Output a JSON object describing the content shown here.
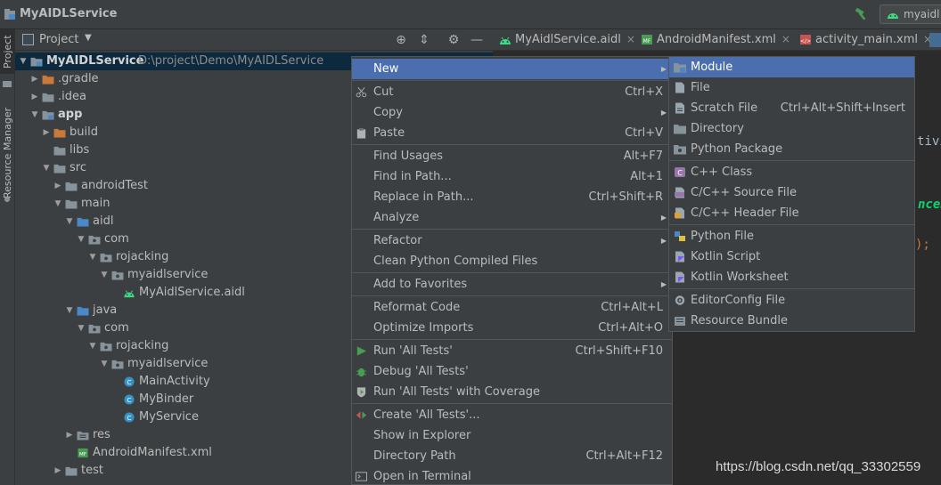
{
  "window": {
    "title": "MyAIDLService",
    "run_config": "myaidl"
  },
  "left_tool_tabs": {
    "project": "Project",
    "resource_manager": "Resource Manager"
  },
  "project_panel": {
    "title": "Project"
  },
  "tree": [
    {
      "label": "MyAIDLService",
      "path": "D:\\project\\Demo\\MyAIDLService",
      "depth": 0,
      "expanded": true,
      "icon": "module-folder-icon",
      "selected": true
    },
    {
      "label": ".gradle",
      "depth": 1,
      "expanded": false,
      "icon": "folder-orange-icon"
    },
    {
      "label": ".idea",
      "depth": 1,
      "expanded": false,
      "icon": "folder-icon"
    },
    {
      "label": "app",
      "depth": 1,
      "expanded": true,
      "icon": "module-folder-icon",
      "bold": true
    },
    {
      "label": "build",
      "depth": 2,
      "expanded": false,
      "icon": "folder-orange-icon"
    },
    {
      "label": "libs",
      "depth": 2,
      "expanded": null,
      "icon": "folder-icon"
    },
    {
      "label": "src",
      "depth": 2,
      "expanded": true,
      "icon": "folder-icon"
    },
    {
      "label": "androidTest",
      "depth": 3,
      "expanded": false,
      "icon": "folder-icon"
    },
    {
      "label": "main",
      "depth": 3,
      "expanded": true,
      "icon": "folder-icon"
    },
    {
      "label": "aidl",
      "depth": 4,
      "expanded": true,
      "icon": "source-folder-icon"
    },
    {
      "label": "com",
      "depth": 5,
      "expanded": true,
      "icon": "package-icon"
    },
    {
      "label": "rojacking",
      "depth": 6,
      "expanded": true,
      "icon": "package-icon"
    },
    {
      "label": "myaidlservice",
      "depth": 7,
      "expanded": true,
      "icon": "package-icon"
    },
    {
      "label": "MyAidlService.aidl",
      "depth": 8,
      "expanded": null,
      "icon": "android-icon"
    },
    {
      "label": "java",
      "depth": 4,
      "expanded": true,
      "icon": "source-folder-icon"
    },
    {
      "label": "com",
      "depth": 5,
      "expanded": true,
      "icon": "package-icon"
    },
    {
      "label": "rojacking",
      "depth": 6,
      "expanded": true,
      "icon": "package-icon"
    },
    {
      "label": "myaidlservice",
      "depth": 7,
      "expanded": true,
      "icon": "package-icon"
    },
    {
      "label": "MainActivity",
      "depth": 8,
      "expanded": null,
      "icon": "class-icon"
    },
    {
      "label": "MyBinder",
      "depth": 8,
      "expanded": null,
      "icon": "class-icon"
    },
    {
      "label": "MyService",
      "depth": 8,
      "expanded": null,
      "icon": "class-icon"
    },
    {
      "label": "res",
      "depth": 4,
      "expanded": false,
      "icon": "resources-folder-icon"
    },
    {
      "label": "AndroidManifest.xml",
      "depth": 4,
      "expanded": null,
      "icon": "manifest-icon"
    },
    {
      "label": "test",
      "depth": 3,
      "expanded": false,
      "icon": "folder-icon"
    }
  ],
  "editor_tabs": [
    {
      "label": "MyAidlService.aidl",
      "icon": "android-icon"
    },
    {
      "label": "AndroidManifest.xml",
      "icon": "manifest-icon"
    },
    {
      "label": "activity_main.xml",
      "icon": "layout-xml-icon"
    }
  ],
  "editor_fragments": {
    "frag1": "tivi",
    "frag2": "nceS",
    "frag3": ");"
  },
  "context_menu": {
    "groups": [
      [
        {
          "label": "New",
          "shortcut": "",
          "submenu": true,
          "icon": "",
          "highlighted": true
        }
      ],
      [
        {
          "label": "Cut",
          "shortcut": "Ctrl+X",
          "submenu": false,
          "icon": "scissors-icon"
        },
        {
          "label": "Copy",
          "shortcut": "",
          "submenu": true,
          "icon": ""
        },
        {
          "label": "Paste",
          "shortcut": "Ctrl+V",
          "submenu": false,
          "icon": "clipboard-icon"
        }
      ],
      [
        {
          "label": "Find Usages",
          "shortcut": "Alt+F7",
          "submenu": false,
          "icon": ""
        },
        {
          "label": "Find in Path...",
          "shortcut": "Alt+1",
          "submenu": false,
          "icon": ""
        },
        {
          "label": "Replace in Path...",
          "shortcut": "Ctrl+Shift+R",
          "submenu": false,
          "icon": ""
        },
        {
          "label": "Analyze",
          "shortcut": "",
          "submenu": true,
          "icon": ""
        }
      ],
      [
        {
          "label": "Refactor",
          "shortcut": "",
          "submenu": true,
          "icon": ""
        },
        {
          "label": "Clean Python Compiled Files",
          "shortcut": "",
          "submenu": false,
          "icon": ""
        }
      ],
      [
        {
          "label": "Add to Favorites",
          "shortcut": "",
          "submenu": true,
          "icon": ""
        }
      ],
      [
        {
          "label": "Reformat Code",
          "shortcut": "Ctrl+Alt+L",
          "submenu": false,
          "icon": ""
        },
        {
          "label": "Optimize Imports",
          "shortcut": "Ctrl+Alt+O",
          "submenu": false,
          "icon": ""
        }
      ],
      [
        {
          "label": "Run 'All Tests'",
          "shortcut": "Ctrl+Shift+F10",
          "submenu": false,
          "icon": "run-icon"
        },
        {
          "label": "Debug 'All Tests'",
          "shortcut": "",
          "submenu": false,
          "icon": "debug-icon"
        },
        {
          "label": "Run 'All Tests' with Coverage",
          "shortcut": "",
          "submenu": false,
          "icon": "coverage-icon"
        }
      ],
      [
        {
          "label": "Create 'All Tests'...",
          "shortcut": "",
          "submenu": false,
          "icon": "create-config-icon"
        },
        {
          "label": "Show in Explorer",
          "shortcut": "",
          "submenu": false,
          "icon": ""
        },
        {
          "label": "Directory Path",
          "shortcut": "Ctrl+Alt+F12",
          "submenu": false,
          "icon": ""
        },
        {
          "label": "Open in Terminal",
          "shortcut": "",
          "submenu": false,
          "icon": "terminal-icon"
        }
      ]
    ]
  },
  "new_submenu": {
    "groups": [
      [
        {
          "label": "Module",
          "shortcut": "",
          "icon": "module-icon",
          "highlighted": true
        },
        {
          "label": "File",
          "shortcut": "",
          "icon": "file-icon"
        },
        {
          "label": "Scratch File",
          "shortcut": "Ctrl+Alt+Shift+Insert",
          "icon": "scratch-file-icon"
        },
        {
          "label": "Directory",
          "shortcut": "",
          "icon": "directory-icon"
        },
        {
          "label": "Python Package",
          "shortcut": "",
          "icon": "python-package-icon"
        }
      ],
      [
        {
          "label": "C++ Class",
          "shortcut": "",
          "icon": "cpp-class-icon"
        },
        {
          "label": "C/C++ Source File",
          "shortcut": "",
          "icon": "cpp-source-icon"
        },
        {
          "label": "C/C++ Header File",
          "shortcut": "",
          "icon": "cpp-header-icon"
        }
      ],
      [
        {
          "label": "Python File",
          "shortcut": "",
          "icon": "python-file-icon"
        },
        {
          "label": "Kotlin Script",
          "shortcut": "",
          "icon": "kotlin-script-icon"
        },
        {
          "label": "Kotlin Worksheet",
          "shortcut": "",
          "icon": "kotlin-worksheet-icon"
        }
      ],
      [
        {
          "label": "EditorConfig File",
          "shortcut": "",
          "icon": "gear-icon"
        },
        {
          "label": "Resource Bundle",
          "shortcut": "",
          "icon": "resource-bundle-icon"
        }
      ]
    ]
  },
  "watermark": "https://blog.csdn.net/qq_33302559",
  "colors": {
    "selection": "#4b6eaf",
    "panel": "#3c3f41",
    "editor": "#2b2b2b"
  }
}
